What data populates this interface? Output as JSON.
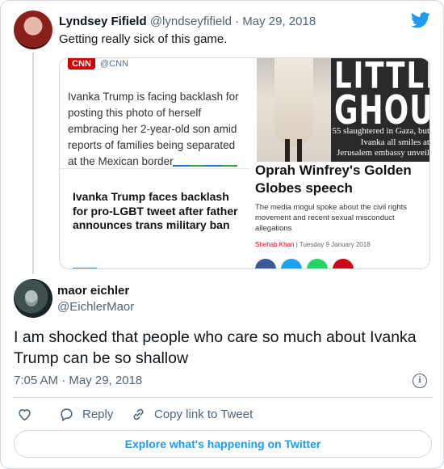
{
  "parent_tweet": {
    "author_name": "Lyndsey Fifield",
    "author_handle": "@lyndseyfifield",
    "separator": "·",
    "date": "May 29, 2018",
    "text": "Getting really sick of this game.",
    "media": {
      "cnn": {
        "logo": "CNN",
        "handle": "@CNN",
        "text": "Ivanka Trump is facing backlash for posting this photo of herself embracing her 2-year-old son amid reports of families being separated at the Mexican border"
      },
      "lgbt_headline": "Ivanka Trump faces backlash for pro-LGBT tweet after father announces trans military ban",
      "tabloid": {
        "title_line1": "LITTLE",
        "title_line2": "GHOUL",
        "subtitle": "55 slaughtered in Gaza, but Ivanka all smiles at Jerusalem embassy unveil"
      },
      "oprah": {
        "title": "Oprah Winfrey's Golden Globes speech",
        "description": "The media mogul spoke about the civil rights movement and recent sexual misconduct allegations",
        "author": "Shehab Khan",
        "byline_sep": "|",
        "date": "Tuesday 9 January 2018"
      }
    }
  },
  "main_tweet": {
    "author_name": "maor eichler",
    "author_handle": "@EichlerMaor",
    "text": "I am shocked that people who care so much about Ivanka Trump can be so shallow",
    "timestamp": "7:05 AM · May 29, 2018"
  },
  "actions": {
    "reply_label": "Reply",
    "copy_label": "Copy link to Tweet"
  },
  "explore_label": "Explore what's happening on Twitter",
  "colors": {
    "twitter_blue": "#1d9bf0",
    "secondary_text": "#536471",
    "border": "#cfd9de",
    "cnn_red": "#cc0000"
  },
  "icons": {
    "brand": "twitter-bird-icon",
    "like": "heart-icon",
    "reply": "speech-bubble-icon",
    "copy": "link-icon",
    "info": "info-icon"
  }
}
